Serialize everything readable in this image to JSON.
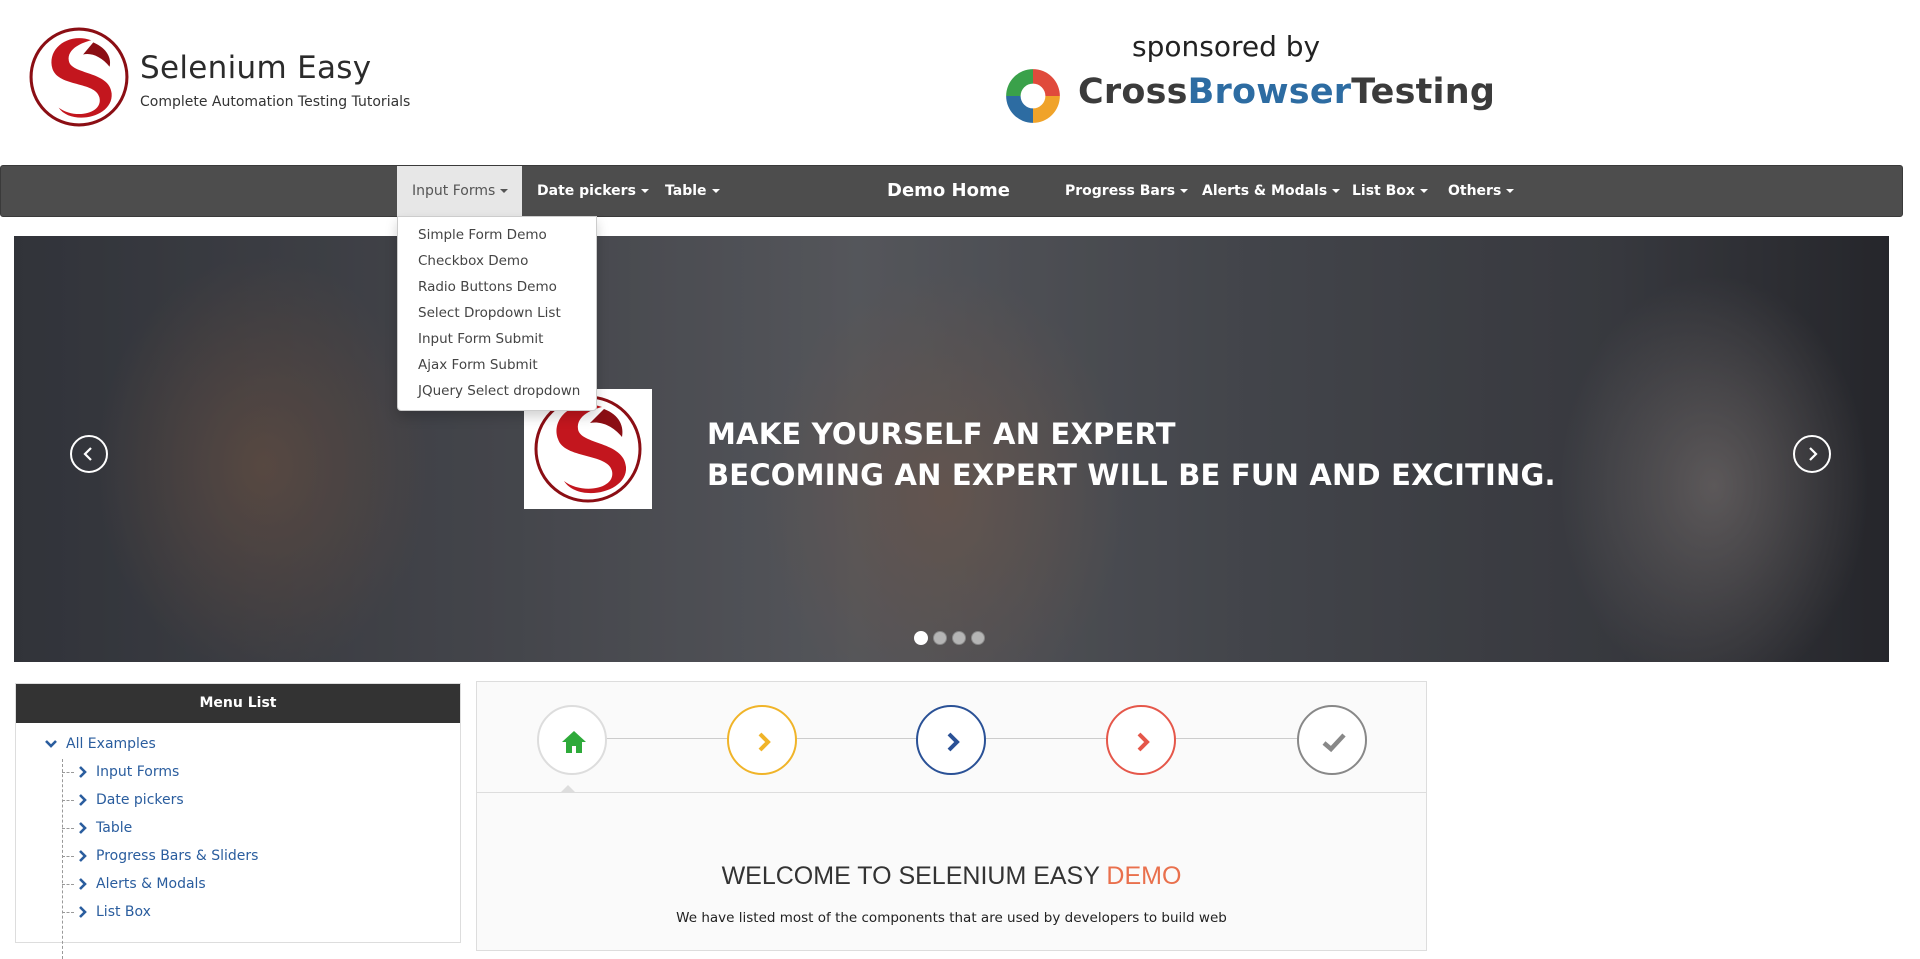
{
  "header": {
    "site_title": "Selenium Easy",
    "site_tagline": "Complete Automation Testing Tutorials",
    "sponsor_text": "sponsored by",
    "sponsor_name_part1": "Cross",
    "sponsor_name_part2": "Browser",
    "sponsor_name_part3": "Testing"
  },
  "navbar": {
    "items": [
      {
        "label": "Input Forms",
        "has_dropdown": true,
        "active": true
      },
      {
        "label": "Date pickers",
        "has_dropdown": true
      },
      {
        "label": "Table",
        "has_dropdown": true
      },
      {
        "label": "Demo Home",
        "has_dropdown": false
      },
      {
        "label": "Progress Bars",
        "has_dropdown": true
      },
      {
        "label": "Alerts & Modals",
        "has_dropdown": true
      },
      {
        "label": "List Box",
        "has_dropdown": true
      },
      {
        "label": "Others",
        "has_dropdown": true
      }
    ],
    "dropdown": [
      "Simple Form Demo",
      "Checkbox Demo",
      "Radio Buttons Demo",
      "Select Dropdown List",
      "Input Form Submit",
      "Ajax Form Submit",
      "JQuery Select dropdown"
    ]
  },
  "carousel": {
    "line1": "MAKE YOURSELF AN EXPERT",
    "line2": "BECOMING AN EXPERT WILL BE FUN AND EXCITING.",
    "slide_count": 4,
    "active_slide": 1
  },
  "menu_list": {
    "title": "Menu List",
    "root": "All Examples",
    "items": [
      "Input Forms",
      "Date pickers",
      "Table",
      "Progress Bars & Sliders",
      "Alerts & Modals",
      "List Box"
    ]
  },
  "welcome": {
    "steps": [
      {
        "icon": "home-icon",
        "color": "#2eaa3a"
      },
      {
        "icon": "chevron-right-icon",
        "color": "#f0b429"
      },
      {
        "icon": "chevron-right-icon",
        "color": "#2a5196"
      },
      {
        "icon": "chevron-right-icon",
        "color": "#e5574a"
      },
      {
        "icon": "check-icon",
        "color": "#888888"
      }
    ],
    "title_main": "WELCOME TO SELENIUM EASY ",
    "title_highlight": "DEMO",
    "text": "We have listed most of the components that are used by developers to build web"
  },
  "colors": {
    "navbar_bg": "#4d4d4d",
    "link_blue": "#2a5d9e",
    "accent_orange": "#e9704d",
    "brand_red": "#b4141c"
  }
}
